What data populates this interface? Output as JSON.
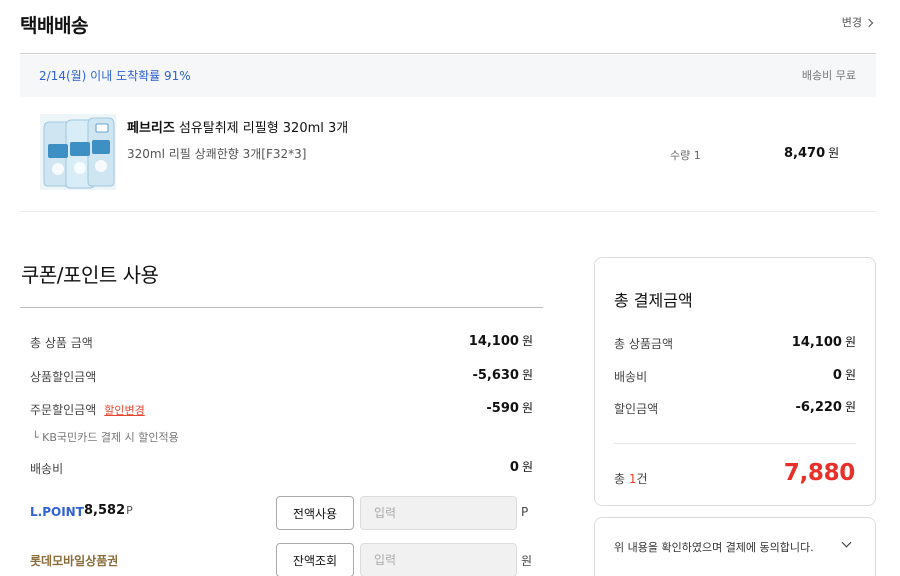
{
  "shipping": {
    "title": "택배배송",
    "change_label": "변경",
    "delivery_date": "2/14(월) 이내 도착확률 91%",
    "delivery_fee": "배송비 무료"
  },
  "product": {
    "brand": "페브리즈",
    "name": "섬유탈취제 리필형 320ml 3개",
    "option": "320ml 리필 상쾌한향 3개[F32*3]",
    "quantity": "수량 1",
    "price": "8,470",
    "price_unit": "원"
  },
  "coupon": {
    "title": "쿠폰/포인트 사용",
    "rows": [
      {
        "label": "총 상품 금액",
        "value": "14,100",
        "unit": "원"
      },
      {
        "label": "상품할인금액",
        "value": "-5,630",
        "unit": "원"
      },
      {
        "label": "주문할인금액",
        "link": "할인변경",
        "value": "-590",
        "unit": "원"
      },
      {
        "label": "배송비",
        "value": "0",
        "unit": "원"
      }
    ],
    "kb_note": "└ KB국민카드 결제 시 할인적용",
    "lpoint": {
      "label": "L.POINT",
      "value": "8,582",
      "unit": "P",
      "button": "전액사용",
      "placeholder": "입력",
      "input_unit": "P"
    },
    "lotte_voucher": {
      "label": "롯데모바일상품권",
      "button": "잔액조회",
      "placeholder": "입력",
      "input_unit": "원"
    }
  },
  "summary": {
    "title": "총 결제금액",
    "rows": [
      {
        "label": "총 상품금액",
        "value": "14,100",
        "unit": "원"
      },
      {
        "label": "배송비",
        "value": "0",
        "unit": "원"
      },
      {
        "label": "할인금액",
        "value": "-6,220",
        "unit": "원"
      }
    ],
    "count_prefix": "총 ",
    "count_num": "1",
    "count_suffix": "건",
    "total": "7,880"
  },
  "agreement": {
    "text": "위 내용을 확인하였으며 결제에 동의합니다."
  },
  "colors": {
    "accent_blue": "#2f63d3",
    "accent_red": "#e8302a",
    "voucher_brown": "#8a6d3b"
  }
}
